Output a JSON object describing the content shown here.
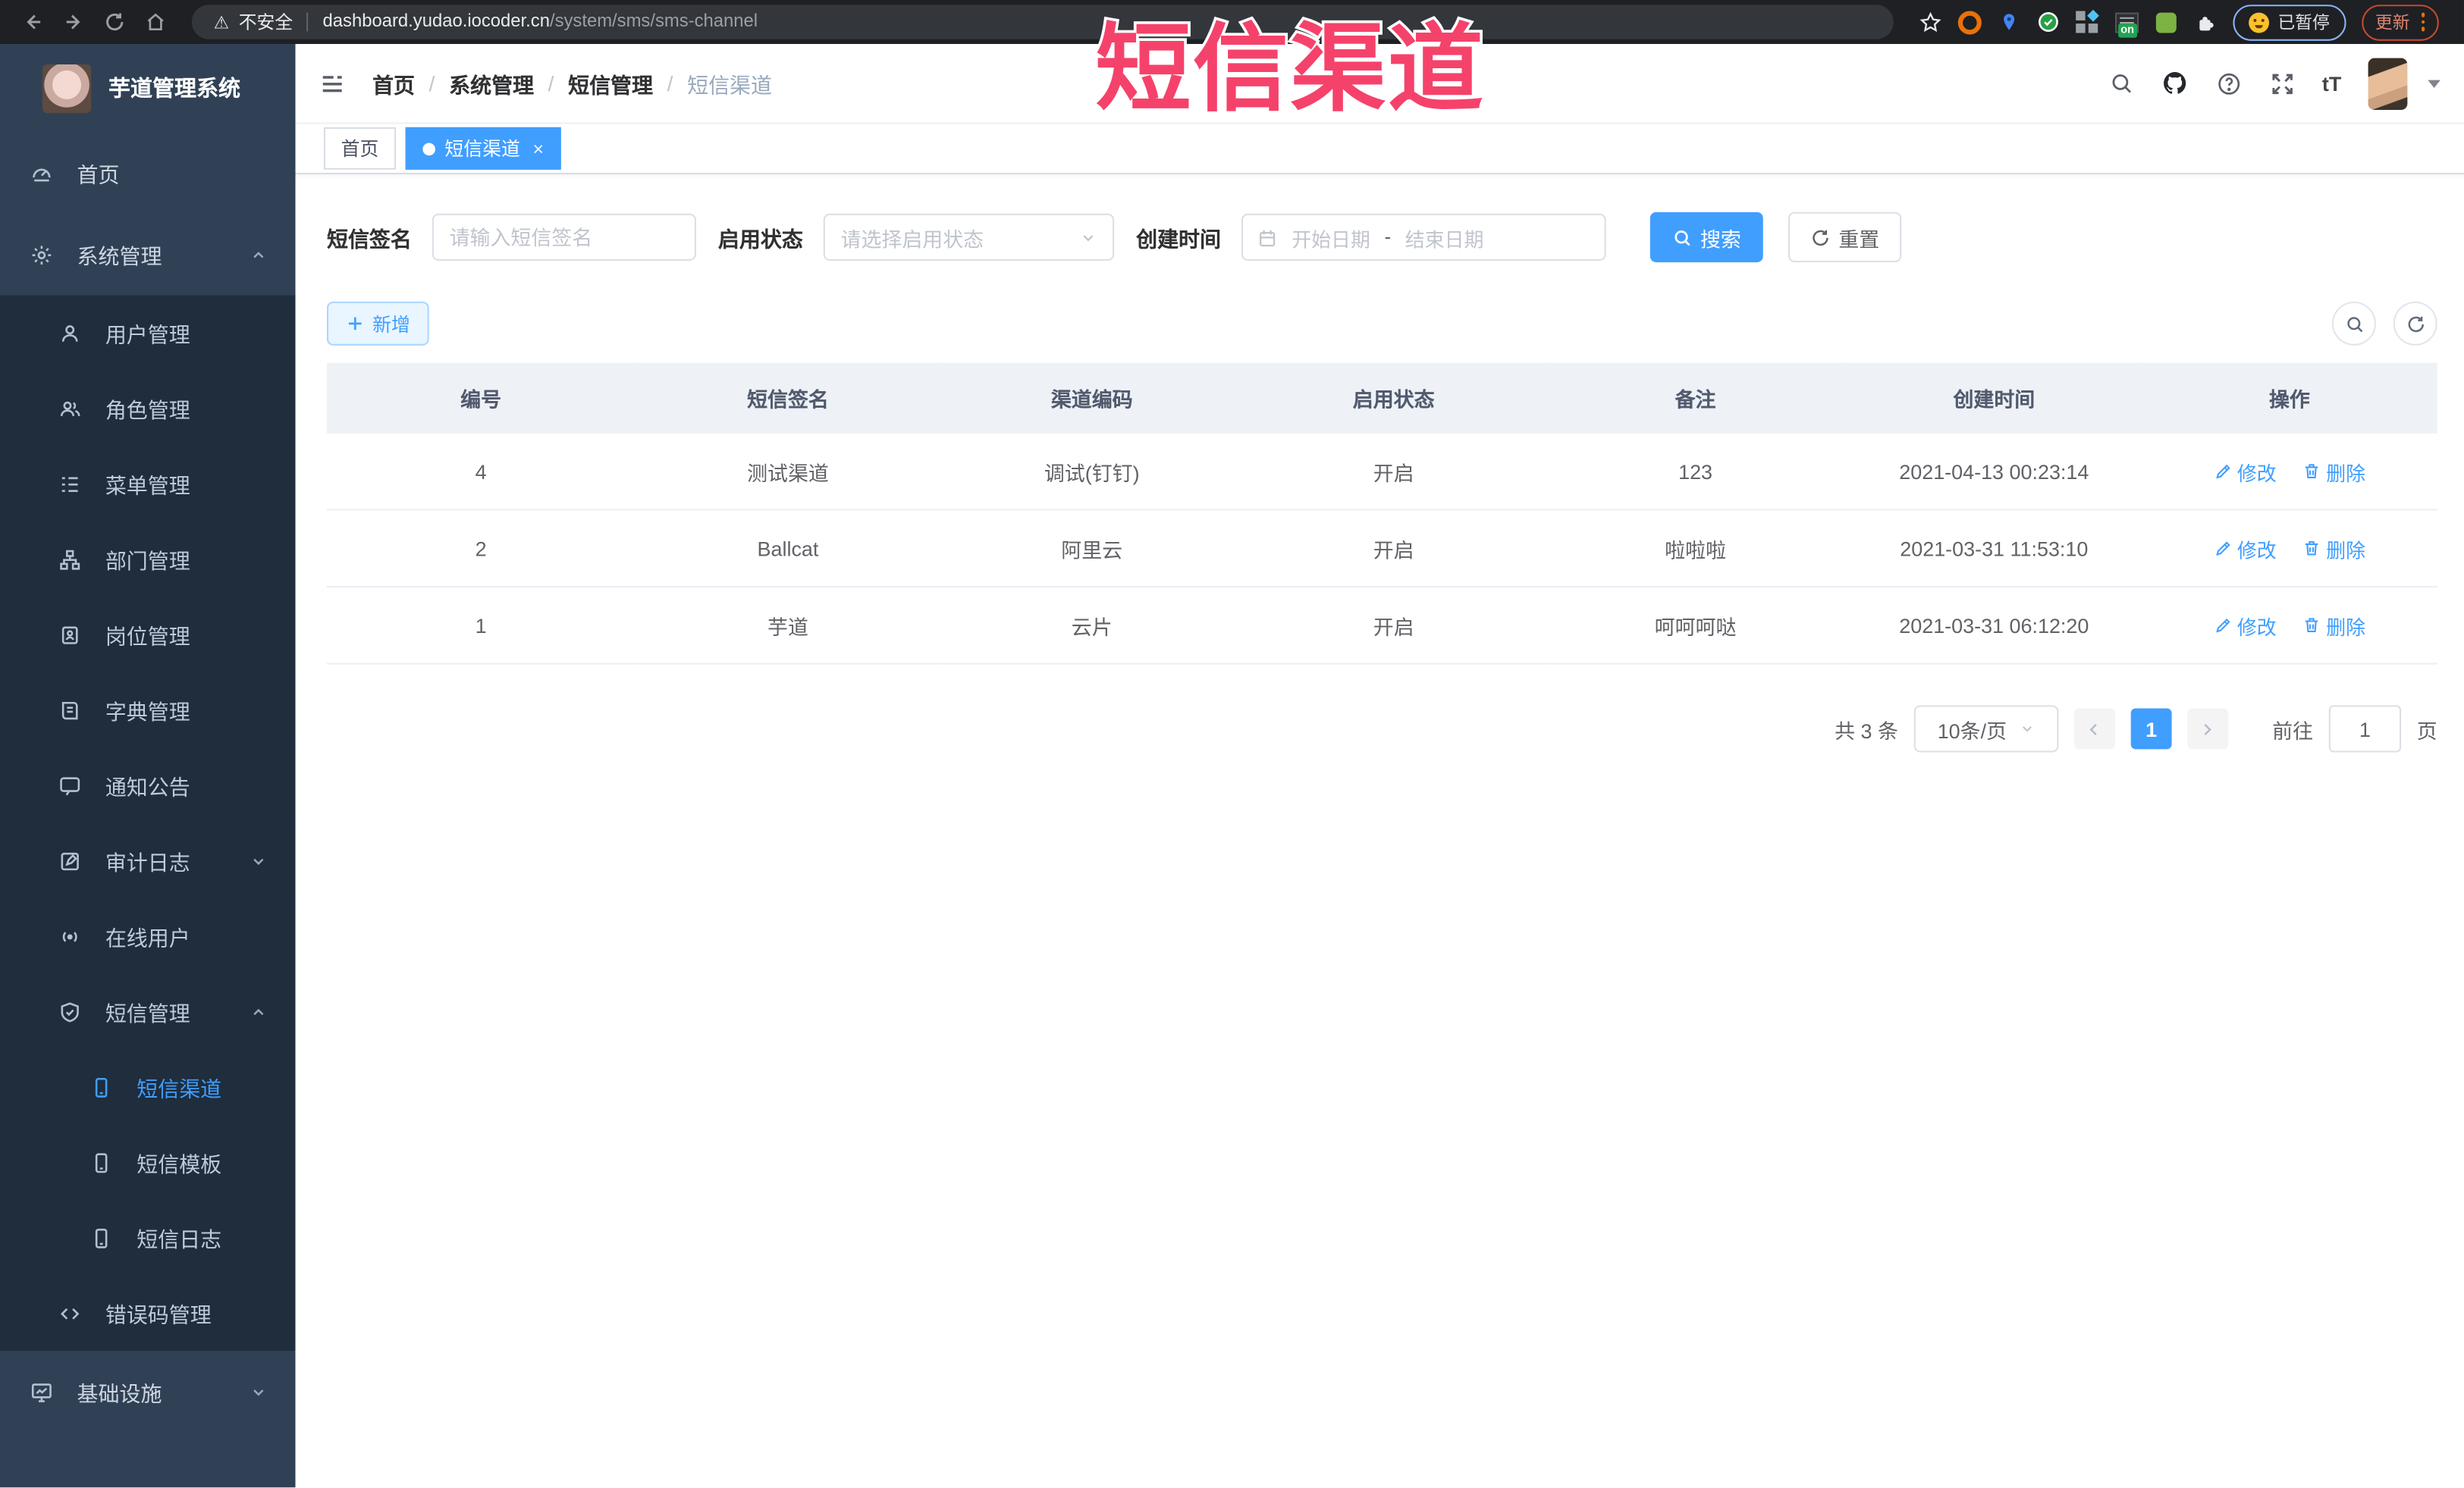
{
  "browser": {
    "security_label": "不安全",
    "url_host": "dashboard.yudao.iocoder.cn",
    "url_path": "/system/sms/sms-channel",
    "extension_on_badge": "on",
    "paused_badge": "已暂停",
    "update_button": "更新"
  },
  "overlay": {
    "title": "短信渠道",
    "color": "#f5426b"
  },
  "sidebar": {
    "app_title": "芋道管理系统",
    "items": [
      {
        "label": "首页",
        "icon": "dashboard-icon"
      },
      {
        "label": "系统管理",
        "icon": "gear-icon"
      },
      {
        "label": "用户管理",
        "icon": "user-icon"
      },
      {
        "label": "角色管理",
        "icon": "users-icon"
      },
      {
        "label": "菜单管理",
        "icon": "menu-tree-icon"
      },
      {
        "label": "部门管理",
        "icon": "org-chart-icon"
      },
      {
        "label": "岗位管理",
        "icon": "id-badge-icon"
      },
      {
        "label": "字典管理",
        "icon": "dictionary-icon"
      },
      {
        "label": "通知公告",
        "icon": "announcement-icon"
      },
      {
        "label": "审计日志",
        "icon": "audit-log-icon"
      },
      {
        "label": "在线用户",
        "icon": "online-users-icon"
      },
      {
        "label": "短信管理",
        "icon": "shield-icon"
      },
      {
        "label": "短信渠道",
        "icon": "phone-icon",
        "active": true
      },
      {
        "label": "短信模板",
        "icon": "phone-icon"
      },
      {
        "label": "短信日志",
        "icon": "phone-icon"
      },
      {
        "label": "错误码管理",
        "icon": "code-icon"
      },
      {
        "label": "基础设施",
        "icon": "monitor-icon"
      }
    ]
  },
  "header": {
    "breadcrumb": [
      "首页",
      "系统管理",
      "短信管理",
      "短信渠道"
    ],
    "text_size_icon": "tT"
  },
  "tabs": {
    "home": "首页",
    "active_tab": "短信渠道"
  },
  "filters": {
    "sign_label": "短信签名",
    "sign_placeholder": "请输入短信签名",
    "status_label": "启用状态",
    "status_placeholder": "请选择启用状态",
    "time_label": "创建时间",
    "start_placeholder": "开始日期",
    "range_separator": "-",
    "end_placeholder": "结束日期",
    "search_button": "搜索",
    "reset_button": "重置"
  },
  "toolbar": {
    "add_button": "新增"
  },
  "table": {
    "columns": [
      "编号",
      "短信签名",
      "渠道编码",
      "启用状态",
      "备注",
      "创建时间",
      "操作"
    ],
    "edit_label": "修改",
    "delete_label": "删除",
    "rows": [
      {
        "id": "4",
        "sign": "测试渠道",
        "code": "调试(钉钉)",
        "status": "开启",
        "remark": "123",
        "created": "2021-04-13 00:23:14"
      },
      {
        "id": "2",
        "sign": "Ballcat",
        "code": "阿里云",
        "status": "开启",
        "remark": "啦啦啦",
        "created": "2021-03-31 11:53:10"
      },
      {
        "id": "1",
        "sign": "芋道",
        "code": "云片",
        "status": "开启",
        "remark": "呵呵呵哒",
        "created": "2021-03-31 06:12:20"
      }
    ]
  },
  "pagination": {
    "total_label": "共 3 条",
    "page_size_label": "10条/页",
    "current_page": "1",
    "goto_label": "前往",
    "goto_value": "1",
    "unit_label": "页"
  },
  "colors": {
    "accent": "#409eff",
    "sidebar_bg": "#304156",
    "submenu_bg": "#1f2d3d"
  }
}
